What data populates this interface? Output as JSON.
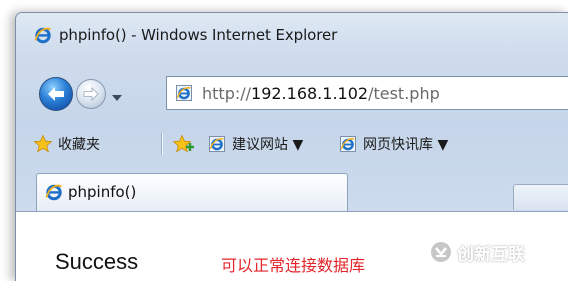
{
  "window": {
    "title": "phpinfo() - Windows Internet Explorer"
  },
  "address_bar": {
    "url_prefix": "http://",
    "url_host": "192.168.1.102",
    "url_path": "/test.php"
  },
  "favorites_bar": {
    "favorites_label": "收藏夹",
    "items": [
      {
        "label": "建议网站 ▼",
        "icon": "ie-page-icon"
      },
      {
        "label": "网页快讯库 ▼",
        "icon": "ie-page-icon"
      }
    ]
  },
  "tabs": [
    {
      "title": "phpinfo()",
      "active": true
    }
  ],
  "content": {
    "success_text": "Success",
    "db_message": "可以正常连接数据库"
  },
  "watermark": {
    "text": "创新互联"
  },
  "colors": {
    "message_red": "#e3252b",
    "ie_blue": "#1e6fc8"
  }
}
